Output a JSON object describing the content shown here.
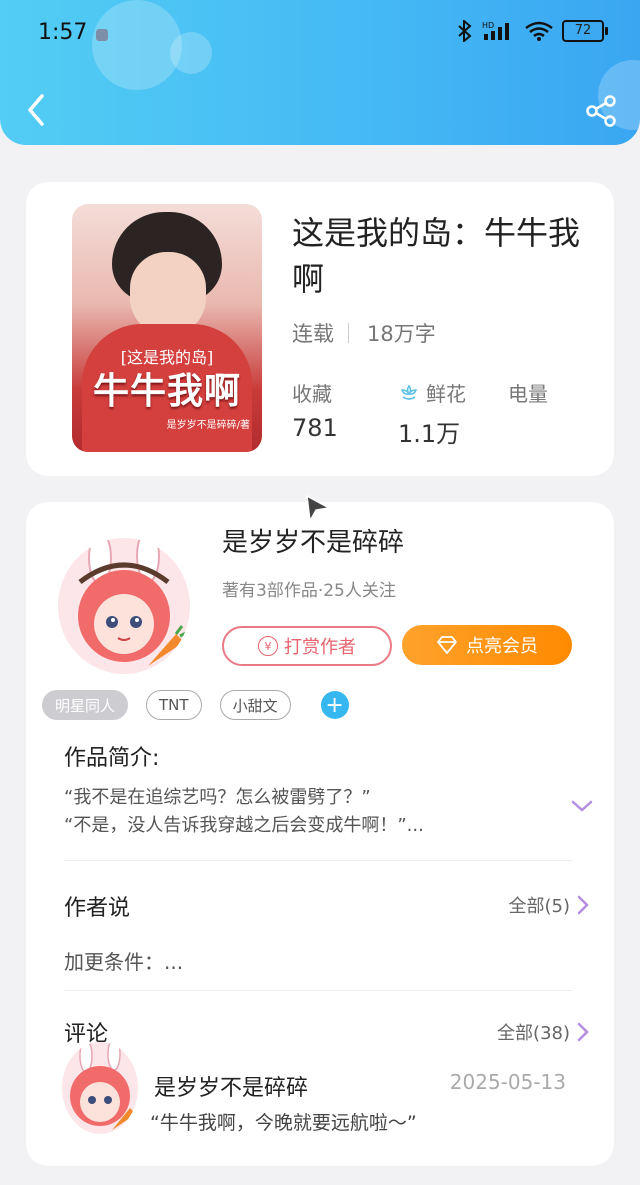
{
  "status": {
    "time": "1:57",
    "battery": "72"
  },
  "book": {
    "title": "这是我的岛：牛牛我啊",
    "status": "连载",
    "word_count": "18万字",
    "cover": {
      "subtitle": "[这是我的岛]",
      "title": "牛牛我啊",
      "author": "是岁岁不是碎碎/著"
    },
    "stats": [
      {
        "label": "收藏",
        "value": "781"
      },
      {
        "label": "鲜花",
        "value": "1.1万"
      },
      {
        "label": "电量",
        "value": ""
      }
    ]
  },
  "author": {
    "name": "是岁岁不是碎碎",
    "summary": "著有3部作品·25人关注",
    "tip_label": "打赏作者",
    "vip_label": "点亮会员"
  },
  "tags": [
    "明星同人",
    "TNT",
    "小甜文"
  ],
  "intro": {
    "heading": "作品简介:",
    "line1": "“我不是在追综艺吗？怎么被雷劈了？”",
    "line2": "“不是，没人告诉我穿越之后会变成牛啊！”..."
  },
  "author_says": {
    "heading": "作者说",
    "all_label": "全部(5)",
    "text": "加更条件：..."
  },
  "comments": {
    "heading": "评论",
    "all_label": "全部(38)",
    "items": [
      {
        "name": "是岁岁不是碎碎",
        "date": "2025-05-13",
        "text": "“牛牛我啊，今晚就要远航啦～”"
      }
    ]
  },
  "colors": {
    "header": "#44b8f4",
    "accent_orange": "#ff8a00",
    "accent_pink": "#e6646f",
    "purple_chevron": "#b48ee0"
  }
}
